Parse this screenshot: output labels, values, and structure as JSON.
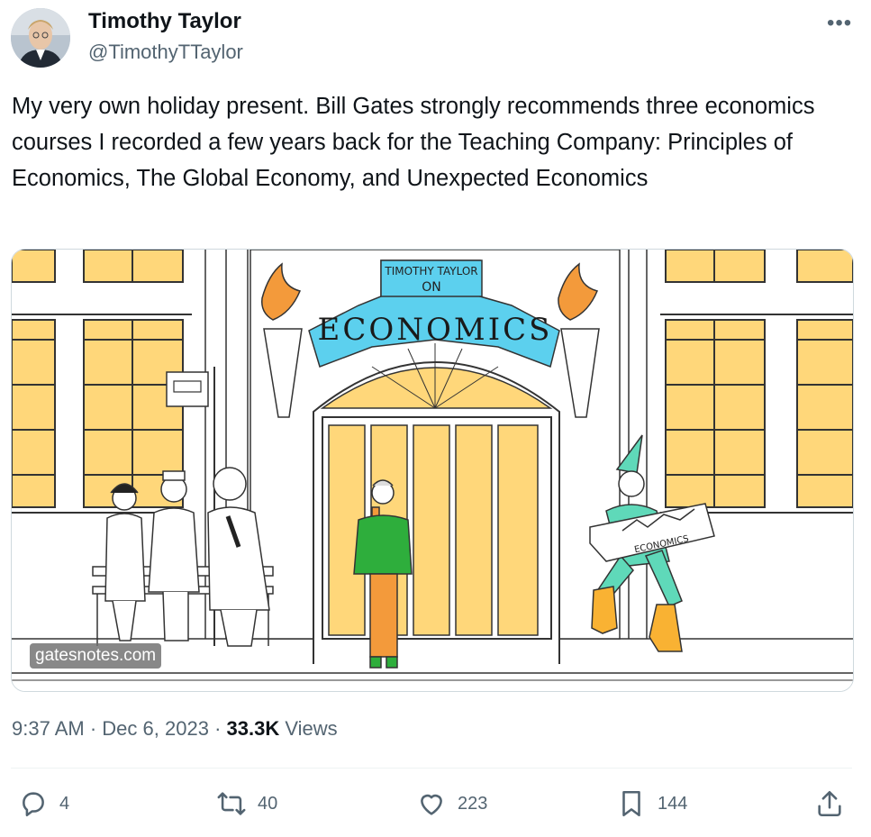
{
  "author": {
    "name": "Timothy Taylor",
    "handle": "@TimothyTTaylor"
  },
  "tweet": {
    "text": "My very own holiday present. Bill Gates strongly recommends three economics courses I recorded a few years back for the Teaching Company: Principles of Economics, The Global Economy, and Unexpected Economics"
  },
  "media": {
    "sign_top": "TIMOTHY TAYLOR",
    "sign_on": "ON",
    "sign_main": "ECONOMICS",
    "elf_sign": "ECONOMICS",
    "watermark": "gatesnotes.com"
  },
  "meta": {
    "time": "9:37 AM",
    "separator": "·",
    "date": "Dec 6, 2023",
    "views_count": "33.3K",
    "views_label": "Views"
  },
  "actions": {
    "replies": "4",
    "reposts": "40",
    "likes": "223",
    "bookmarks": "144"
  },
  "colors": {
    "accent_yellow": "#ffd77a",
    "sign_blue": "#5cd0ee",
    "text_primary": "#0f1419",
    "text_secondary": "#536471"
  },
  "icons": [
    "more-icon",
    "reply-icon",
    "repost-icon",
    "like-icon",
    "bookmark-icon",
    "share-icon"
  ]
}
